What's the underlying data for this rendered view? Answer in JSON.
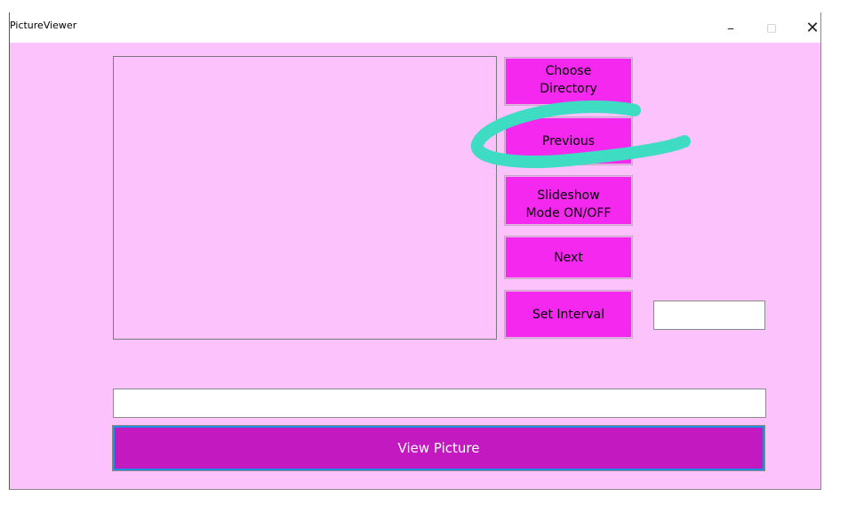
{
  "window": {
    "title": "PictureViewer",
    "minimize_glyph": "–",
    "maximize_glyph": "□",
    "close_glyph": "✕"
  },
  "buttons": {
    "choose_directory": "Choose\nDirectory",
    "previous": "Previous",
    "slideshow": "Slideshow\nMode ON/OFF",
    "next": "Next",
    "set_interval": "Set Interval",
    "view_picture": "View Picture"
  },
  "inputs": {
    "interval_value": "",
    "path_value": ""
  },
  "colors": {
    "background": "#fbc2fb",
    "button": "#f528f0",
    "view_button": "#c21ac0",
    "scribble": "#3fdcc4"
  }
}
